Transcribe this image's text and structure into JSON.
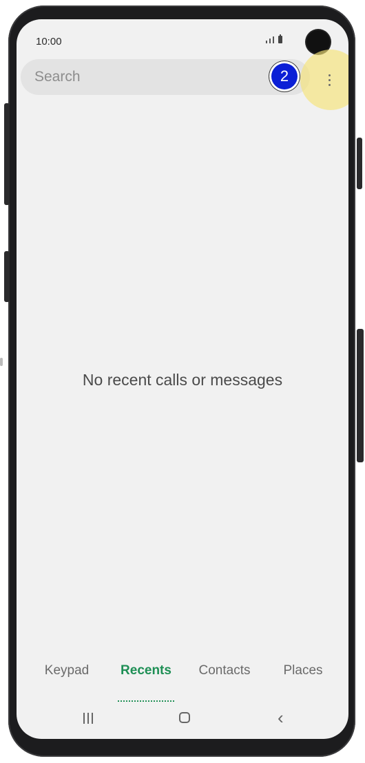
{
  "status_bar": {
    "time": "10:00"
  },
  "search": {
    "placeholder": "Search"
  },
  "annotation": {
    "step_number": "2"
  },
  "recents": {
    "empty_message": "No recent calls or messages"
  },
  "tabs": [
    {
      "label": "Keypad",
      "active": false
    },
    {
      "label": "Recents",
      "active": true
    },
    {
      "label": "Contacts",
      "active": false
    },
    {
      "label": "Places",
      "active": false
    }
  ],
  "navigation": {
    "recent_apps_icon": "recent-apps-icon",
    "home_icon": "home-icon",
    "back_icon": "back-icon"
  },
  "colors": {
    "accent_green": "#1e8f55",
    "badge_blue": "#0b1fd6",
    "highlight_yellow": "#f6e478"
  }
}
